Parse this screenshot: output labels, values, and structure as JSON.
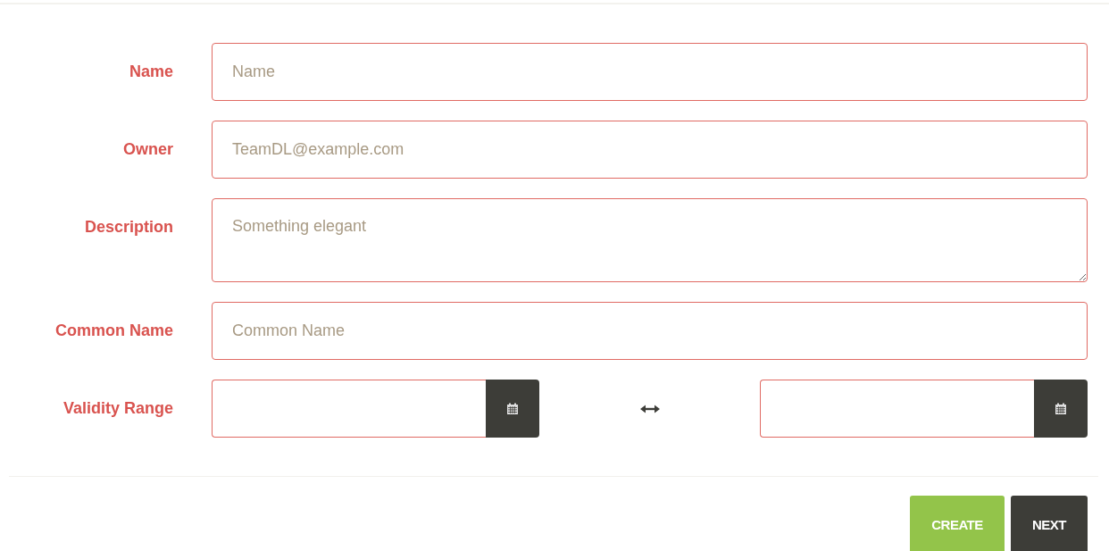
{
  "fields": [
    {
      "kind": "text",
      "label": "Name",
      "placeholder": "Name"
    },
    {
      "kind": "text",
      "label": "Owner",
      "placeholder": "TeamDL@example.com"
    },
    {
      "kind": "textarea",
      "label": "Description",
      "placeholder": "Something elegant"
    },
    {
      "kind": "text",
      "label": "Common Name",
      "placeholder": "Common Name"
    },
    {
      "kind": "daterange",
      "label": "Validity Range"
    }
  ],
  "buttons": [
    {
      "kind": "primary",
      "label": "CREATE"
    },
    {
      "kind": "secondary",
      "label": "NEXT"
    }
  ]
}
